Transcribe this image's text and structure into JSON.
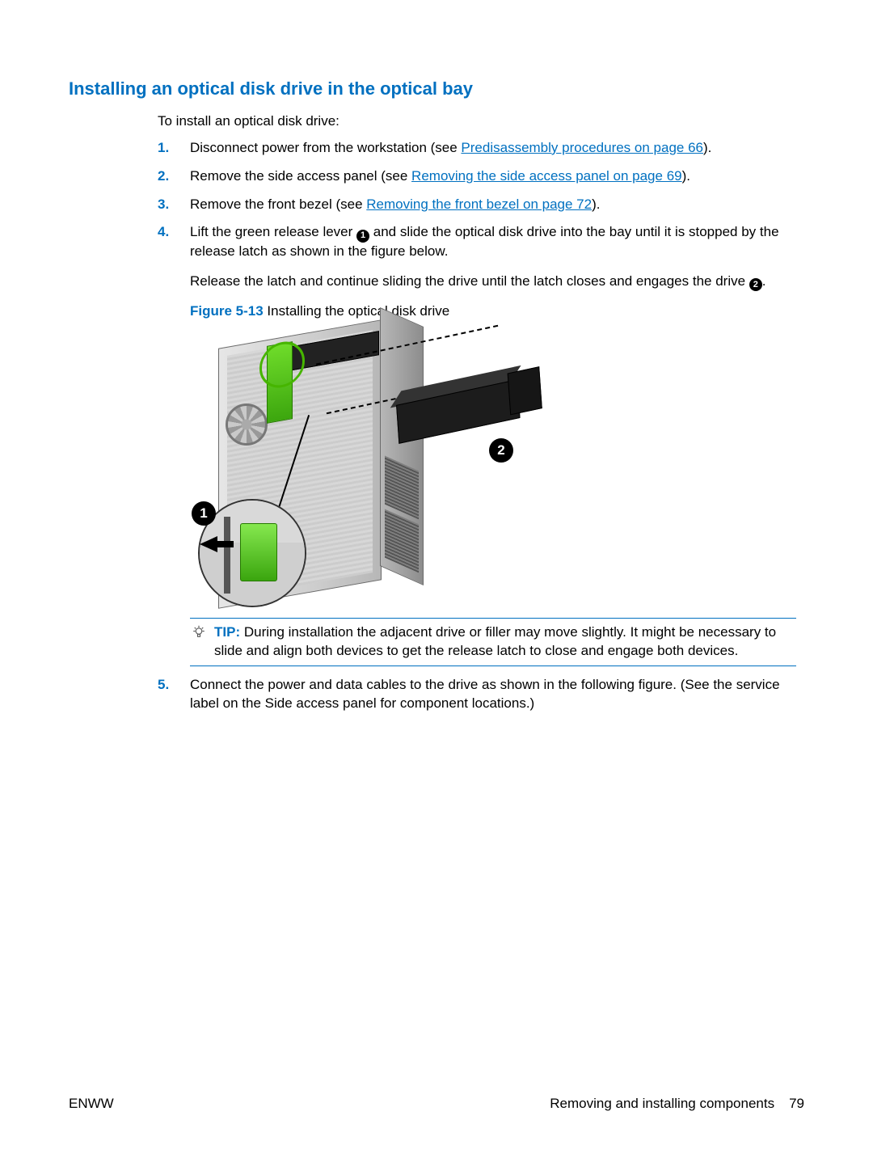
{
  "heading": "Installing an optical disk drive in the optical bay",
  "intro": "To install an optical disk drive:",
  "steps": {
    "s1a": "Disconnect power from the workstation (see ",
    "s1link": "Predisassembly procedures on page 66",
    "s1b": ").",
    "s2a": "Remove the side access panel (see ",
    "s2link": "Removing the side access panel on page 69",
    "s2b": ").",
    "s3a": "Remove the front bezel (see ",
    "s3link": "Removing the front bezel on page 72",
    "s3b": ").",
    "s4a": "Lift the green release lever ",
    "s4b": " and slide the optical disk drive into the bay until it is stopped by the release latch as shown in the figure below.",
    "s4sub_a": "Release the latch and continue sliding the drive until the latch closes and engages the drive ",
    "s4sub_b": ".",
    "s5": "Connect the power and data cables to the drive as shown in the following figure. (See the service label on the Side access panel for component locations.)"
  },
  "callouts": {
    "one": "1",
    "two": "2"
  },
  "figure": {
    "label": "Figure 5-13",
    "caption": "  Installing the optical disk drive",
    "marker1": "1",
    "marker2": "2"
  },
  "tip": {
    "label": "TIP:",
    "text": "   During installation the adjacent drive or filler may move slightly. It might be necessary to slide and align both devices to get the release latch to close and engage both devices."
  },
  "footer": {
    "left": "ENWW",
    "right_text": "Removing and installing components",
    "page": "79"
  }
}
